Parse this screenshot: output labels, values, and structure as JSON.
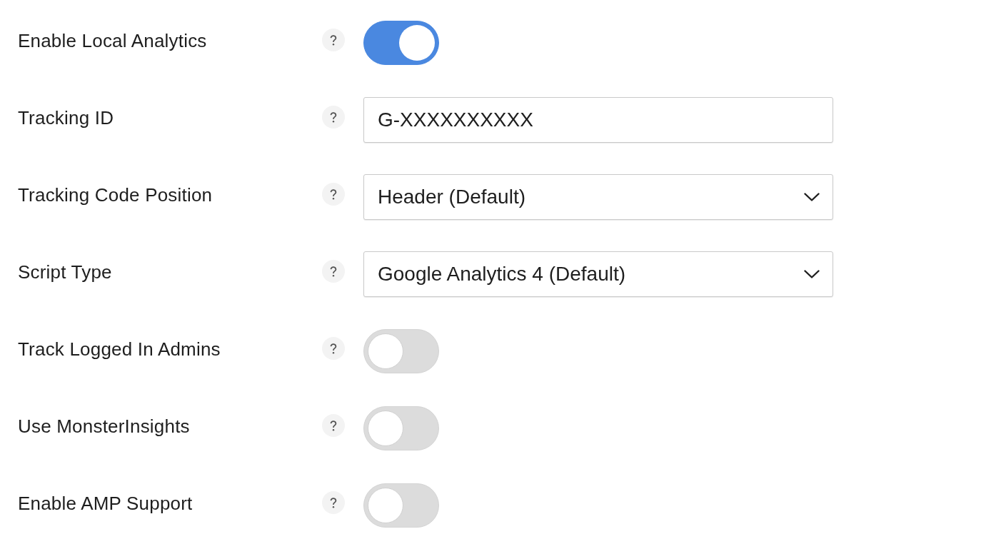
{
  "settings": [
    {
      "label": "Enable Local Analytics",
      "kind": "toggle",
      "on": true
    },
    {
      "label": "Tracking ID",
      "kind": "text",
      "value": "G-XXXXXXXXXX"
    },
    {
      "label": "Tracking Code Position",
      "kind": "select",
      "value": "Header (Default)"
    },
    {
      "label": "Script Type",
      "kind": "select",
      "value": "Google Analytics 4 (Default)"
    },
    {
      "label": "Track Logged In Admins",
      "kind": "toggle",
      "on": false
    },
    {
      "label": "Use MonsterInsights",
      "kind": "toggle",
      "on": false
    },
    {
      "label": "Enable AMP Support",
      "kind": "toggle",
      "on": false
    }
  ]
}
